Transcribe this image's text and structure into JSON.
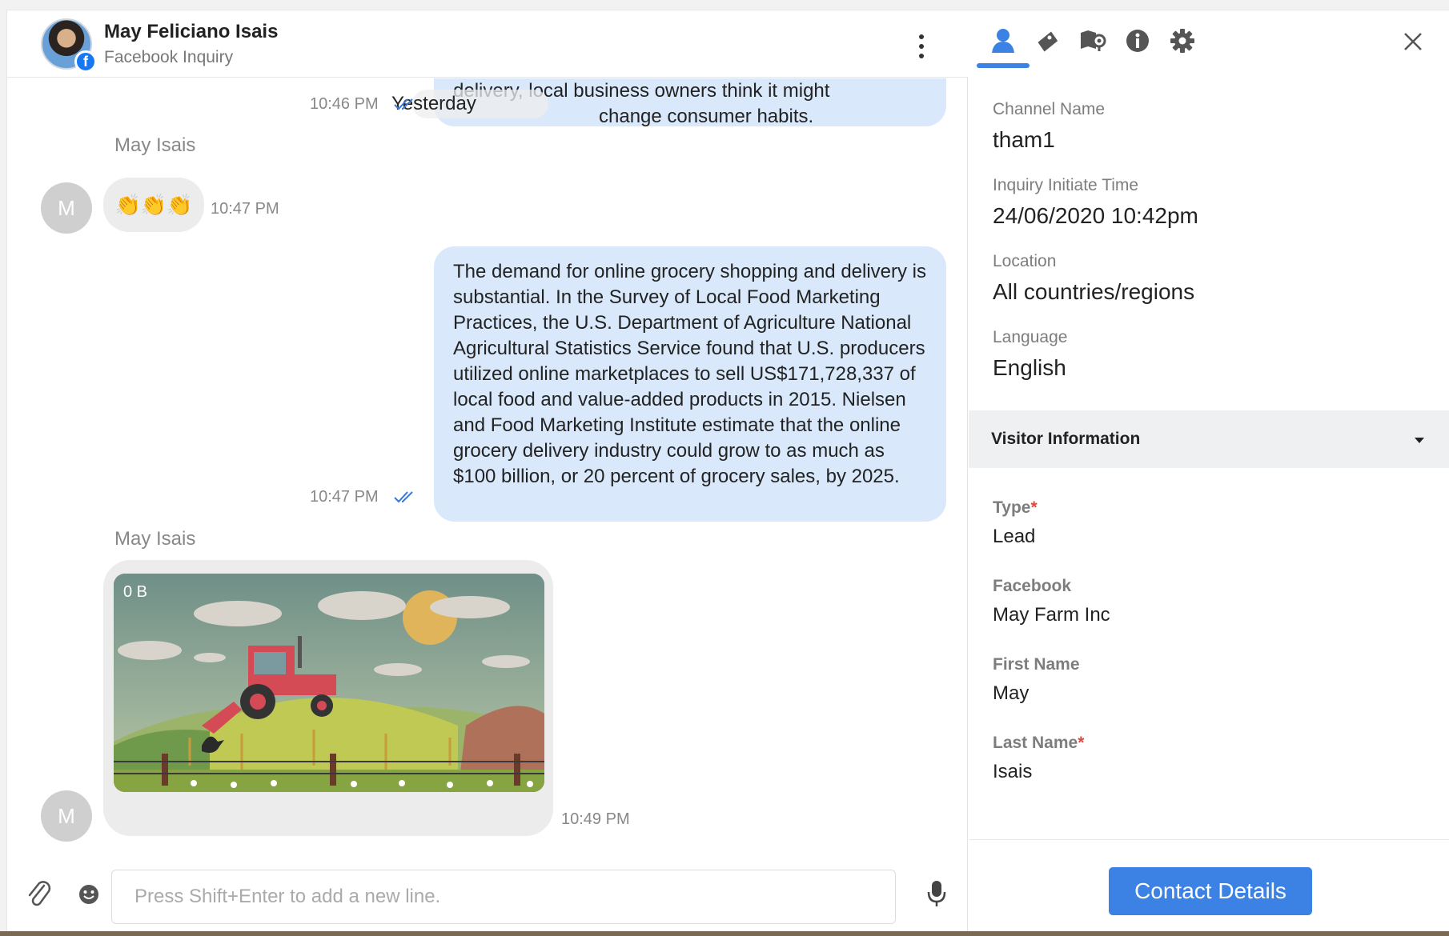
{
  "header": {
    "contact_name": "May Feliciano Isais",
    "contact_subtitle": "Facebook Inquiry",
    "fb_badge_letter": "f"
  },
  "messages": {
    "outgoing_1": {
      "line_1": "delivery, local business owners think it might",
      "line_2": "change consumer habits.",
      "time": "10:46 PM"
    },
    "date_separator": "Yesterday",
    "incoming_1": {
      "sender": "May Isais",
      "avatar_letter": "M",
      "text": "👏👏👏",
      "time": "10:47 PM"
    },
    "outgoing_2": {
      "text": "The demand for online grocery shopping and delivery is substantial. In the Survey of Local Food Marketing Practices, the U.S. Department of Agriculture National Agricultural Statistics Service found that U.S. producers utilized online marketplaces to sell US$171,728,337 of local food and value-added products in 2015. Nielsen and Food Marketing Institute estimate that the online grocery delivery industry could grow to as much as $100 billion, or 20 percent of grocery sales, by 2025.",
      "time": "10:47 PM"
    },
    "incoming_2": {
      "sender": "May Isais",
      "avatar_letter": "M",
      "image_size": "0 B",
      "time": "10:49 PM"
    }
  },
  "composer": {
    "placeholder": "Press Shift+Enter to add a new line."
  },
  "side_panel": {
    "tabs": [
      "person-icon",
      "ticket-icon",
      "location-icon",
      "info-icon",
      "settings-icon"
    ],
    "active_tab": "person-icon",
    "fields": {
      "channel_name": {
        "label": "Channel Name",
        "value": "tham1"
      },
      "initiate_time": {
        "label": "Inquiry Initiate Time",
        "value": "24/06/2020 10:42pm"
      },
      "location": {
        "label": "Location",
        "value": "All countries/regions"
      },
      "language": {
        "label": "Language",
        "value": "English"
      }
    },
    "visitor_section_title": "Visitor Information",
    "visitor": {
      "type": {
        "label": "Type",
        "required_mark": "*",
        "value": "Lead"
      },
      "facebook": {
        "label": "Facebook",
        "value": "May Farm Inc"
      },
      "first_name": {
        "label": "First Name",
        "value": "May"
      },
      "last_name": {
        "label": "Last Name",
        "required_mark": "*",
        "value": "Isais"
      }
    },
    "contact_details_button": "Contact Details"
  },
  "colors": {
    "accent": "#3b82e4",
    "outgoing_bubble": "#d9e9fb",
    "incoming_bubble": "#ececec",
    "required": "#e0473f"
  }
}
